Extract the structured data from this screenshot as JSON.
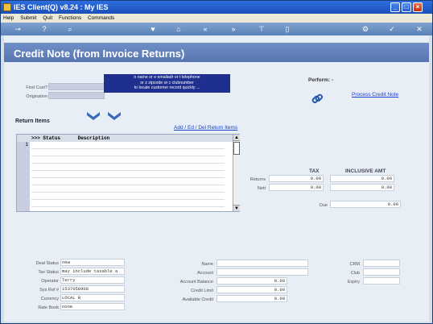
{
  "window": {
    "title": "IES Client(Q) v8.24 : My IES"
  },
  "menu": {
    "items": [
      "Help",
      "Submit",
      "Quit",
      "Functions",
      "Commands"
    ]
  },
  "page": {
    "title": "Credit Note (from Invoice Returns)"
  },
  "customer": {
    "find_label": "Find Cust?",
    "origination_label": "Origination",
    "tooltip": [
      "n name or e emailadr or t telephone",
      "or z zipcode or c clubnumber",
      "to locate customer record quickly ..."
    ]
  },
  "perform": {
    "label": "Perform: -",
    "process_link": "Process Credit Note"
  },
  "return_items": {
    "title": "Return Items",
    "edit_link": "Add / Ed / Del Return Items",
    "header": ">>> Status      Description",
    "row_number": "1"
  },
  "totals": {
    "tax_header": "TAX",
    "incl_header": "INCLUSIVE AMT",
    "returns_label": "Returns",
    "nett_label": "Nett",
    "due_label": "Due",
    "returns_tax": "0.00",
    "returns_incl": "0.00",
    "nett_tax": "0.00",
    "nett_incl": "0.00",
    "due": "0.00"
  },
  "deal": {
    "deal_status_label": "Deal Status",
    "deal_status": "new",
    "tax_status_label": "Tax Status",
    "tax_status": "may include taxable a",
    "operator_label": "Operator",
    "operator": "Terry",
    "sys_ref_label": "Sys Ref #",
    "sys_ref": "1537058908",
    "currency_label": "Currency",
    "currency": "LOCAL R",
    "rate_book_label": "Rate Book",
    "rate_book": "none"
  },
  "account": {
    "name_label": "Name",
    "account_label": "Account",
    "balance_label": "Account Balance",
    "balance": "0.00",
    "credit_limit_label": "Credit Limit",
    "credit_limit": "0.00",
    "available_label": "Available Credit",
    "available": "0.00"
  },
  "crm": {
    "crm_label": "CRM",
    "club_label": "Club",
    "expiry_label": "Expiry"
  }
}
